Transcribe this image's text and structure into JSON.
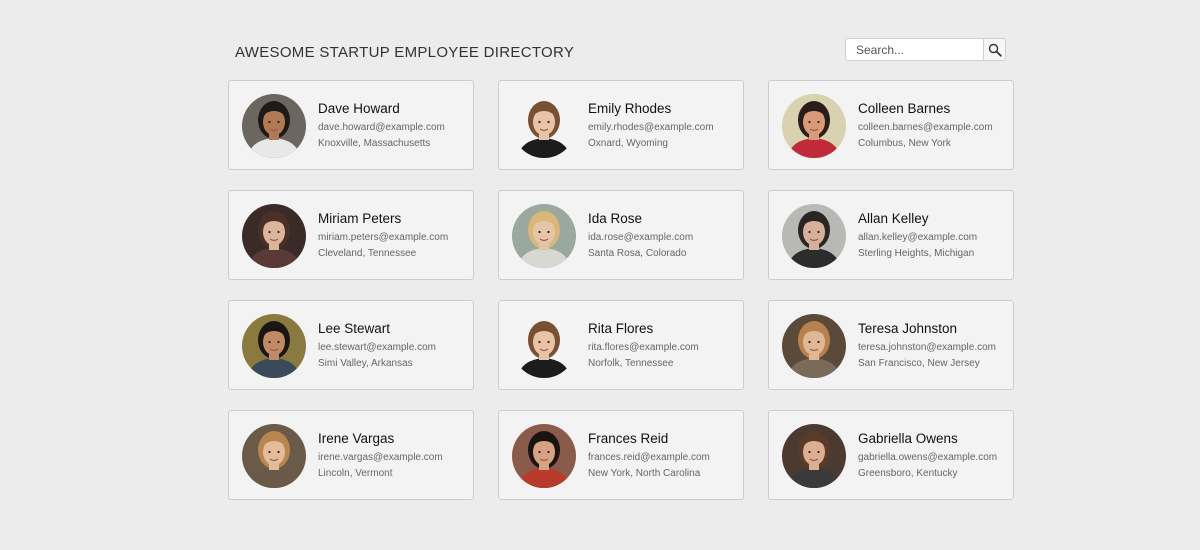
{
  "header": {
    "title": "AWESOME STARTUP EMPLOYEE DIRECTORY"
  },
  "search": {
    "placeholder": "Search...",
    "button_icon": "magnifier-icon"
  },
  "employees": [
    {
      "name": "Dave Howard",
      "email": "dave.howard@example.com",
      "location": "Knoxville, Massachusetts",
      "avatar": {
        "bg": "#6b6660",
        "skin": "#b07a56",
        "hair": "#1e1a18",
        "shirt": "#e8e8e8"
      }
    },
    {
      "name": "Emily Rhodes",
      "email": "emily.rhodes@example.com",
      "location": "Oxnard, Wyoming",
      "avatar": {
        "bg": "#f4f4f4",
        "skin": "#e8c3a8",
        "hair": "#7a5034",
        "shirt": "#1c1c1c"
      }
    },
    {
      "name": "Colleen Barnes",
      "email": "colleen.barnes@example.com",
      "location": "Columbus, New York",
      "avatar": {
        "bg": "#d8d2b0",
        "skin": "#d89a78",
        "hair": "#2a1c18",
        "shirt": "#c02a3a"
      }
    },
    {
      "name": "Miriam Peters",
      "email": "miriam.peters@example.com",
      "location": "Cleveland, Tennessee",
      "avatar": {
        "bg": "#3a2a28",
        "skin": "#dcb49a",
        "hair": "#4a3028",
        "shirt": "#5a3a36"
      }
    },
    {
      "name": "Ida Rose",
      "email": "ida.rose@example.com",
      "location": "Santa Rosa, Colorado",
      "avatar": {
        "bg": "#9aa8a0",
        "skin": "#e6c4a6",
        "hair": "#d8b878",
        "shirt": "#d8d8d2"
      }
    },
    {
      "name": "Allan Kelley",
      "email": "allan.kelley@example.com",
      "location": "Sterling Heights, Michigan",
      "avatar": {
        "bg": "#b8b8b4",
        "skin": "#d6b09a",
        "hair": "#2a2624",
        "shirt": "#2c2c2c"
      }
    },
    {
      "name": "Lee Stewart",
      "email": "lee.stewart@example.com",
      "location": "Simi Valley, Arkansas",
      "avatar": {
        "bg": "#8a7a40",
        "skin": "#c08a66",
        "hair": "#1a1614",
        "shirt": "#3a4a5a"
      }
    },
    {
      "name": "Rita Flores",
      "email": "rita.flores@example.com",
      "location": "Norfolk, Tennessee",
      "avatar": {
        "bg": "#f4f4f4",
        "skin": "#e8c3a8",
        "hair": "#7a5034",
        "shirt": "#1c1c1c"
      }
    },
    {
      "name": "Teresa Johnston",
      "email": "teresa.johnston@example.com",
      "location": "San Francisco, New Jersey",
      "avatar": {
        "bg": "#5a4a3a",
        "skin": "#e0b898",
        "hair": "#b8824e",
        "shirt": "#7a6a5a"
      }
    },
    {
      "name": "Irene Vargas",
      "email": "irene.vargas@example.com",
      "location": "Lincoln, Vermont",
      "avatar": {
        "bg": "#6a5a48",
        "skin": "#e4bc9c",
        "hair": "#b8864e",
        "shirt": "#6a5848"
      }
    },
    {
      "name": "Frances Reid",
      "email": "frances.reid@example.com",
      "location": "New York, North Carolina",
      "avatar": {
        "bg": "#8a5a4a",
        "skin": "#d6a282",
        "hair": "#1a1412",
        "shirt": "#b83a2a"
      }
    },
    {
      "name": "Gabriella Owens",
      "email": "gabriella.owens@example.com",
      "location": "Greensboro, Kentucky",
      "avatar": {
        "bg": "#4a3a30",
        "skin": "#dcae92",
        "hair": "#5a3a28",
        "shirt": "#3a3a3a"
      }
    }
  ]
}
